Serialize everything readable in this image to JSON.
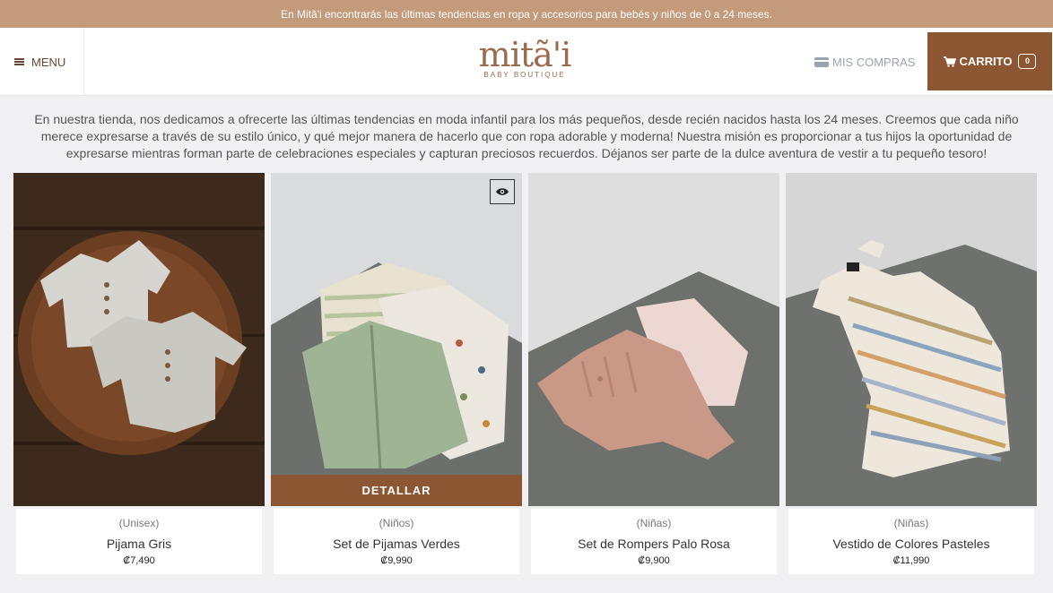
{
  "announcement": "En Mitã'i encontrarás las últimas tendencias en ropa y accesorios para bebés y niños de 0 a 24 meses.",
  "header": {
    "menu_label": "MENU",
    "logo_text": "mitã'i",
    "logo_sub": "BABY BOUTIQUE",
    "mis_compras_label": "MIS COMPRAS",
    "cart_label": "CARRITO",
    "cart_count": "0"
  },
  "intro": "En nuestra tienda, nos dedicamos a ofrecerte las últimas tendencias en moda infantil para los más pequeños, desde recién nacidos hasta los 24 meses. Creemos que cada niño merece expresarse a través de su estilo único, y qué mejor manera de hacerlo que con ropa adorable y moderna! Nuestra misión es proporcionar a tus hijos la oportunidad de expresarse mientras forman parte de celebraciones especiales y capturan preciosos recuerdos. Déjanos ser parte de la dulce aventura de vestir a tu pequeño tesoro!",
  "detail_label": "DETALLAR",
  "products": [
    {
      "category": "(Unisex)",
      "name": "Pijama Gris",
      "price": "₡7,490"
    },
    {
      "category": "(Niños)",
      "name": "Set de Pijamas Verdes",
      "price": "₡9,990"
    },
    {
      "category": "(Niñas)",
      "name": "Set de Rompers Palo Rosa",
      "price": "₡9,900"
    },
    {
      "category": "(Niñas)",
      "name": "Vestido de Colores Pasteles",
      "price": "₡11,990"
    }
  ],
  "colors": {
    "brand": "#8c5632",
    "topbar": "#c39a7a",
    "logo": "#9a6b4c"
  }
}
